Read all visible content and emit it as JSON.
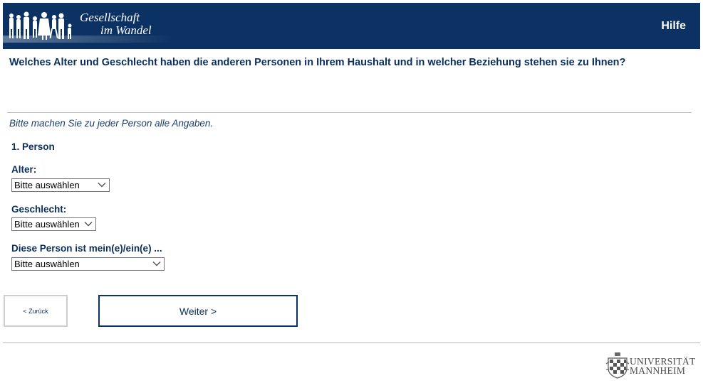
{
  "header": {
    "brand_line1": "Gesellschaft",
    "brand_line2": "im Wandel",
    "help_label": "Hilfe"
  },
  "question": "Welches Alter und Geschlecht haben die anderen Personen in Ihrem Haushalt und in welcher Beziehung stehen sie zu Ihnen?",
  "hint": "Bitte machen Sie zu jeder Person alle Angaben.",
  "person": {
    "title": "1. Person",
    "fields": [
      {
        "label": "Alter:",
        "value": "Bitte auswählen"
      },
      {
        "label": "Geschlecht:",
        "value": "Bitte auswählen"
      },
      {
        "label": "Diese Person ist mein(e)/ein(e) ...",
        "value": "Bitte auswählen"
      }
    ]
  },
  "nav": {
    "back_label": "< Zurück",
    "next_label": "Weiter >"
  },
  "footer": {
    "university_line1": "UNIVERSITÄT",
    "university_line2": "MANNHEIM"
  },
  "colors": {
    "header_bg": "#0b3263",
    "text": "#0a2e5c",
    "divider": "#b8b8b8"
  }
}
